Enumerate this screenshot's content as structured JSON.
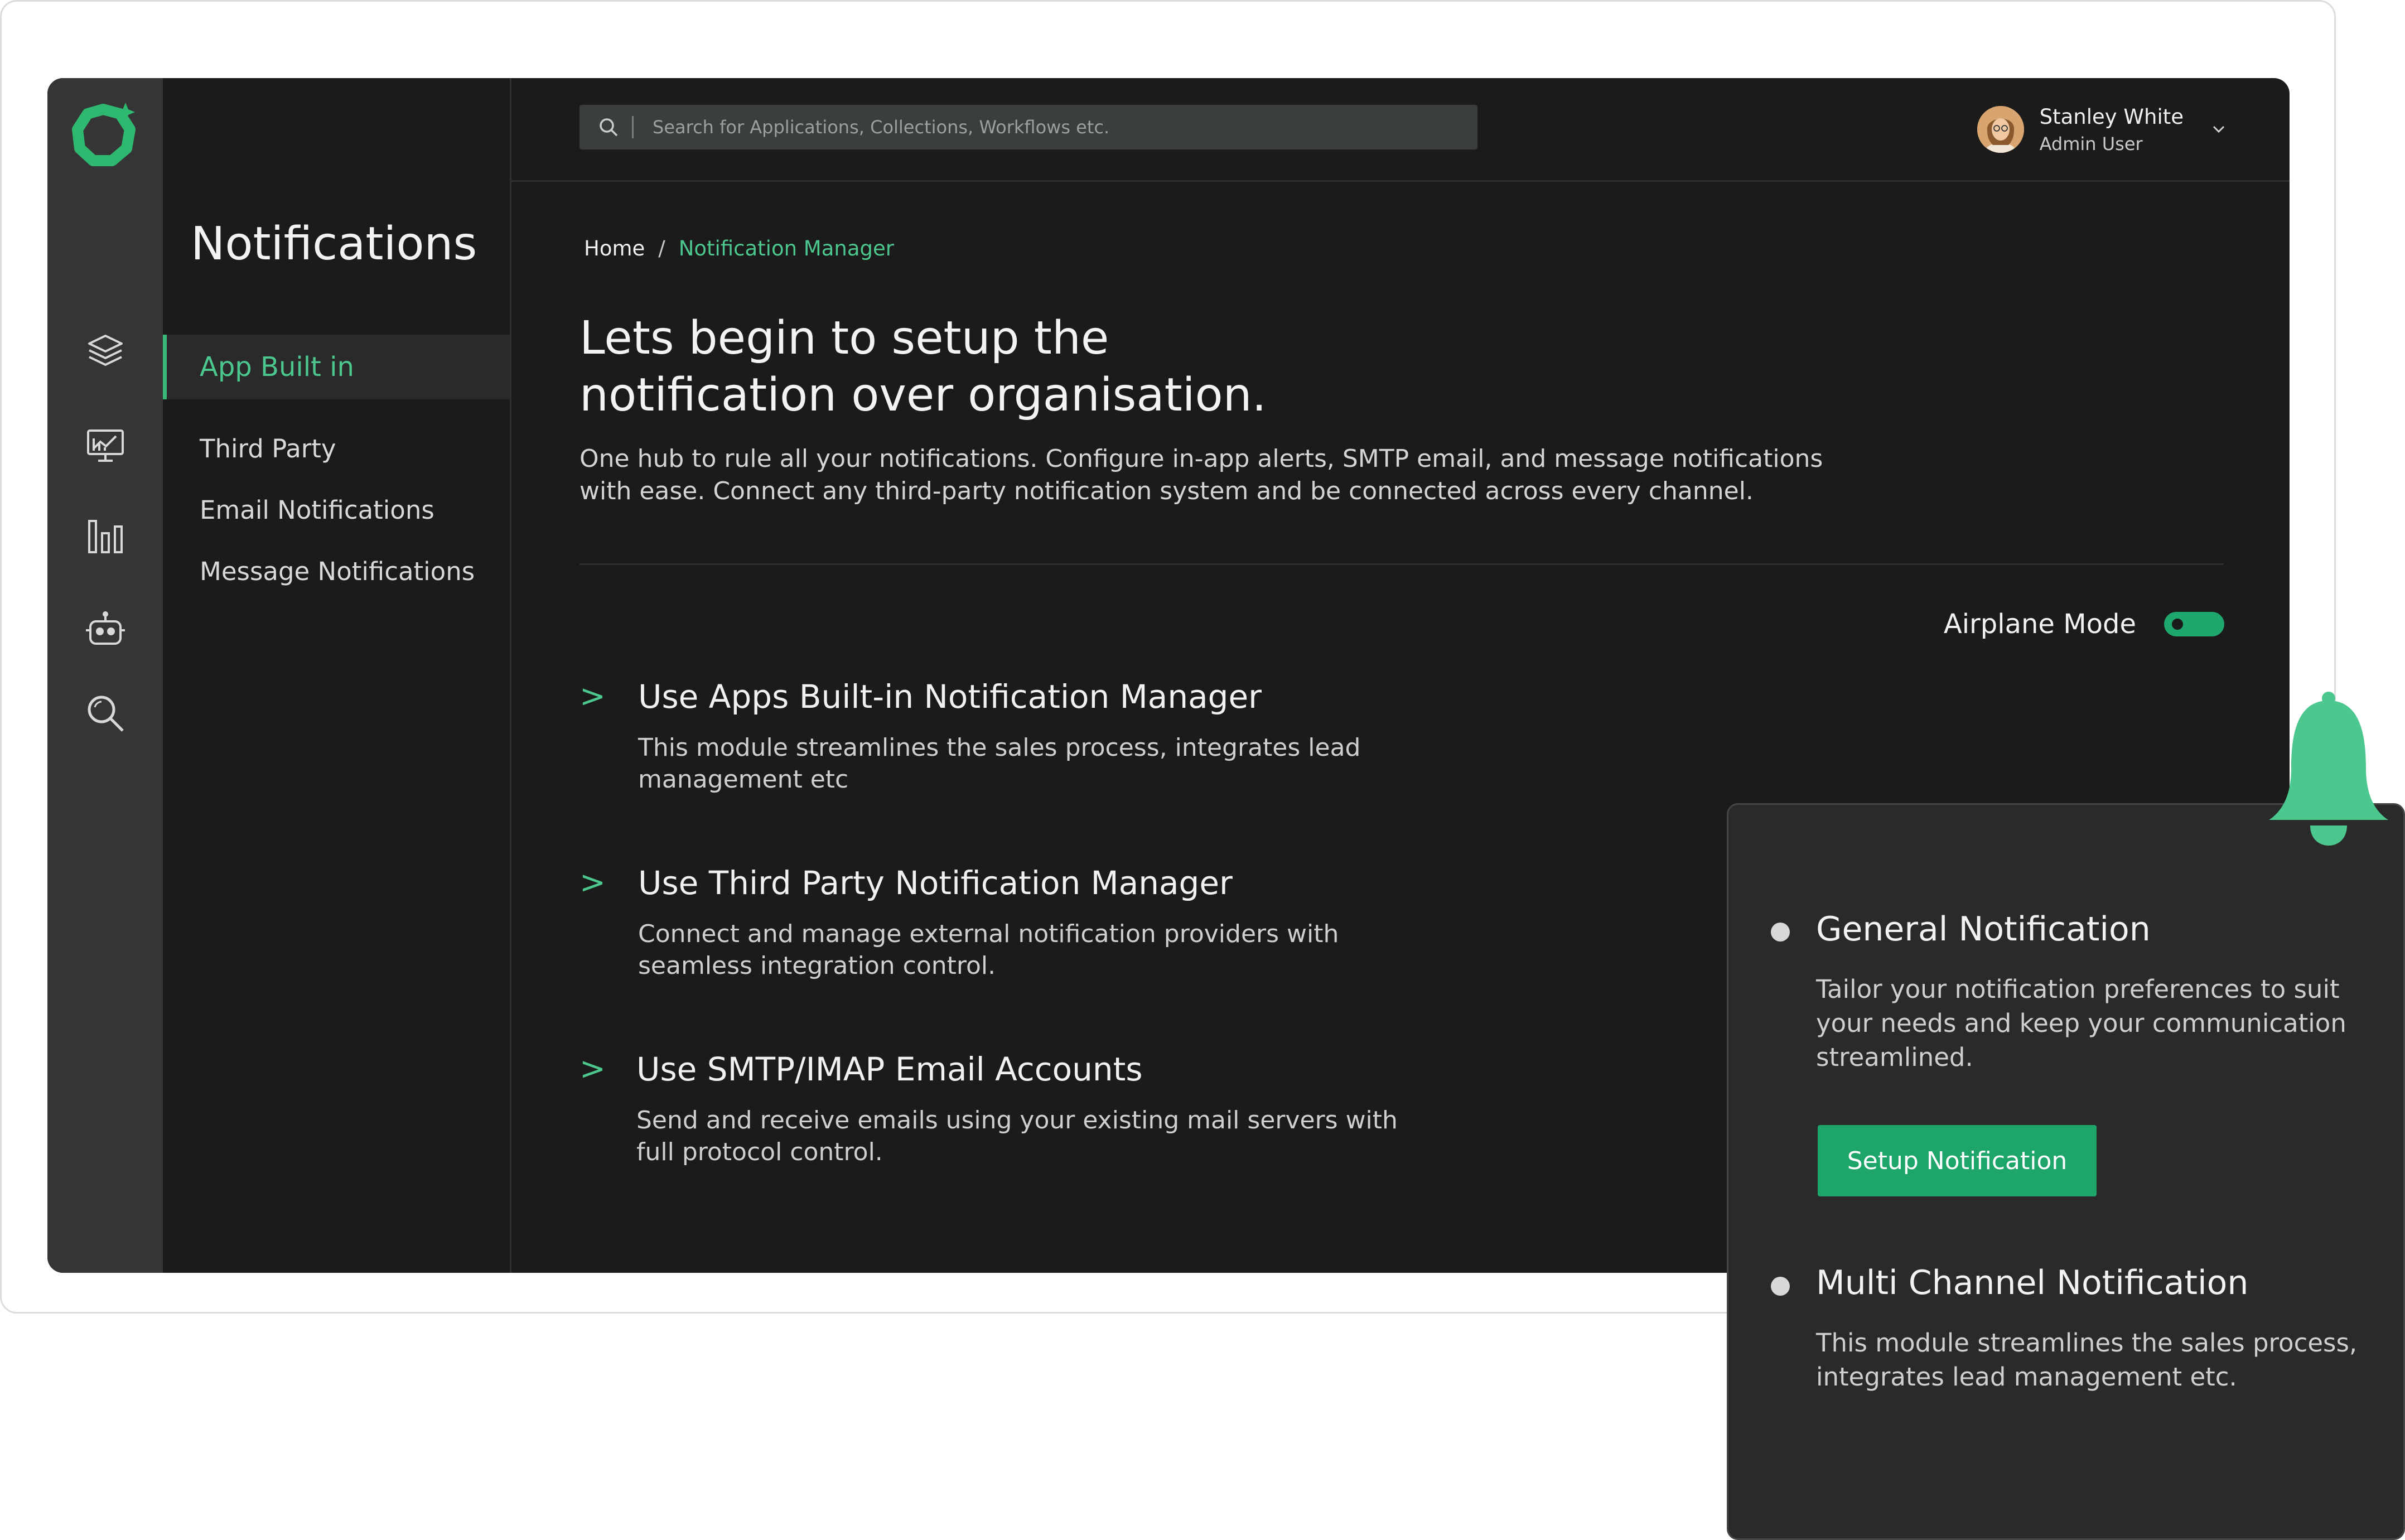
{
  "colors": {
    "accent": "#4cc88e",
    "button": "#1ea66a",
    "background": "#1b1b1b",
    "rail": "#353535"
  },
  "icons": {
    "logo": "brand-ring-sparkle-logo",
    "rail": [
      "layers-icon",
      "monitor-chart-icon",
      "bar-chart-icon",
      "robot-icon",
      "search-zoom-icon"
    ],
    "search": "search-icon",
    "dropdown": "chevron-down-icon",
    "notification": "bell-icon"
  },
  "sidebar": {
    "title": "Notifications",
    "items": [
      {
        "label": "App Built in",
        "active": true
      },
      {
        "label": "Third Party",
        "active": false
      },
      {
        "label": "Email Notifications",
        "active": false
      },
      {
        "label": "Message Notifications",
        "active": false
      }
    ]
  },
  "header": {
    "search": {
      "placeholder": "Search for Applications, Collections, Workflows etc."
    },
    "user": {
      "name": "Stanley White",
      "role": "Admin User"
    }
  },
  "breadcrumb": {
    "home": "Home",
    "separator": "/",
    "current": "Notification Manager"
  },
  "main": {
    "headline_line1": "Lets begin to setup the",
    "headline_line2": "notification over organisation.",
    "intro": "One hub to rule all your notifications. Configure in-app alerts, SMTP email, and message notifications with ease. Connect any third-party notification system and be connected across every channel.",
    "airplane": {
      "label": "Airplane Mode",
      "on": true
    },
    "options": [
      {
        "arrow": ">",
        "title": "Use Apps Built-in Notification Manager",
        "desc": "This module streamlines the sales process, integrates lead management etc"
      },
      {
        "arrow": ">",
        "title": "Use Third Party Notification Manager",
        "desc": "Connect and manage external notification providers with seamless integration control."
      },
      {
        "arrow": ">",
        "title": "Use SMTP/IMAP Email Accounts",
        "desc": "Send and receive emails using your existing mail servers with full protocol control."
      }
    ]
  },
  "popup": {
    "items": [
      {
        "title": "General Notification",
        "desc": "Tailor your notification preferences to suit your needs and keep your communication streamlined.",
        "button": "Setup Notification"
      },
      {
        "title": "Multi Channel Notification",
        "desc": "This module streamlines the sales process, integrates lead management etc."
      }
    ]
  }
}
